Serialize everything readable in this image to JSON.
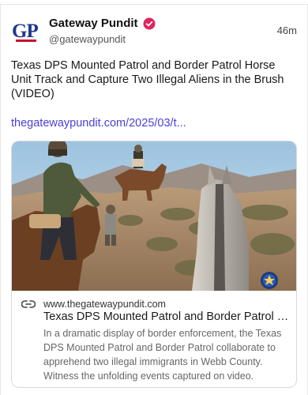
{
  "author": {
    "avatar_text": "GP",
    "name": "Gateway Pundit",
    "handle": "@gatewaypundit",
    "time": "46m"
  },
  "post": {
    "text": "Texas DPS Mounted Patrol and Border Patrol Horse Unit Track and Capture Two Illegal Aliens in the Brush (VIDEO)",
    "link": "thegatewaypundit.com/2025/03/t..."
  },
  "link_card": {
    "domain": "www.thegatewaypundit.com",
    "title": "Texas DPS Mounted Patrol and Border Patrol Horse Unit Track and Capture Two Illegal Aliens in the Brush (VIDEO)",
    "description": "In a dramatic display of border enforcement, the Texas DPS Mounted Patrol and Border Patrol collaborate to apprehend two illegal immigrants in Webb County. Witness the unfolding events captured on video."
  },
  "colors": {
    "accent_link": "#4a3fd6",
    "verified_badge": "#e0245e",
    "brand_blue": "#1d3a8a"
  }
}
